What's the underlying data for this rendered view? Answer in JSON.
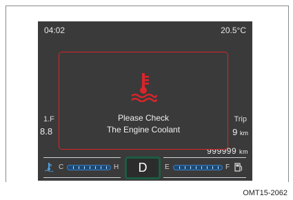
{
  "cluster": {
    "clock": "04:02",
    "outside_temp": "20.5°C",
    "gear": "D"
  },
  "trip": {
    "left_label": "1.F",
    "left_value": "8.8",
    "right_label": "Trip",
    "right_value": "9",
    "right_unit": "km",
    "odometer": "999999",
    "odometer_unit": "km"
  },
  "alert": {
    "line1": "Please Check",
    "line2": "The Engine Coolant",
    "icon": "coolant-temperature-icon",
    "color": "#d9252b"
  },
  "gauges": {
    "coolant": {
      "icon": "coolant-temp-icon",
      "low": "C",
      "high": "H"
    },
    "fuel": {
      "icon": "fuel-pump-icon",
      "low": "E",
      "high": "F"
    }
  },
  "figure_code": "OMT15-2062"
}
